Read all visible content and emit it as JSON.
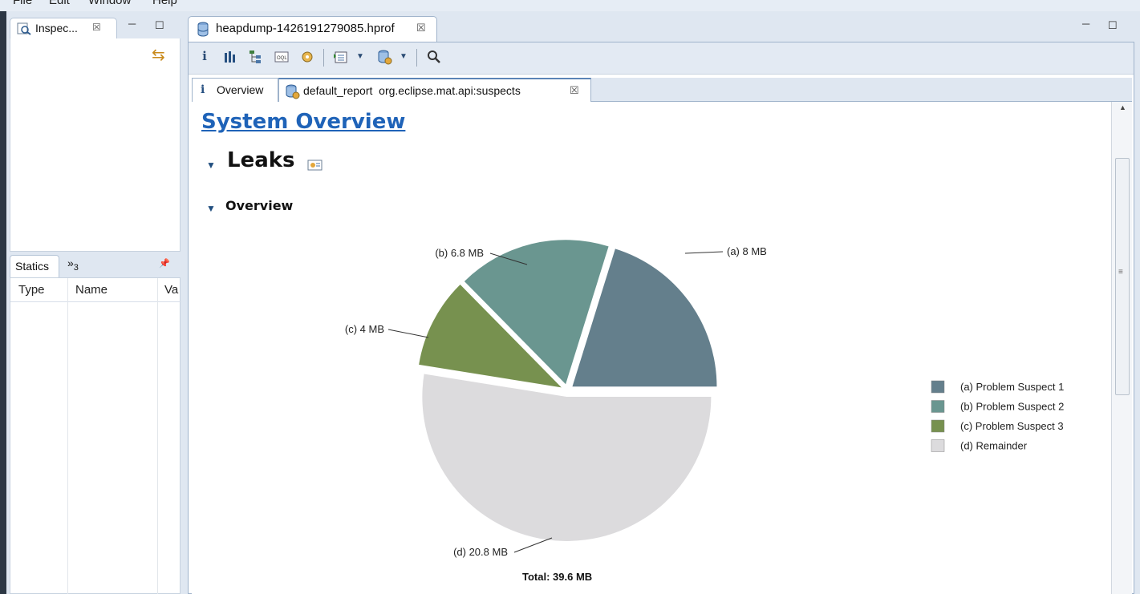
{
  "menu": [
    "File",
    "Edit",
    "Window",
    "Help"
  ],
  "inspector": {
    "tab_label": "Inspec...",
    "close_glyph": "☒",
    "min_glyph": "─",
    "max_glyph": "☐",
    "sync_glyph": "⇆"
  },
  "statics": {
    "tab_label": "Statics",
    "overflow_label": "»",
    "overflow_count": "3",
    "pin_glyph": "📌",
    "columns": [
      "Type",
      "Name",
      "Va"
    ]
  },
  "editor": {
    "tab_label": "heapdump-1426191279085.hprof",
    "close_glyph": "☒",
    "min_glyph": "─",
    "max_glyph": "☐",
    "toolbar_icons": [
      "info-icon",
      "histogram-icon",
      "dominator-tree-icon",
      "oql-icon",
      "thread-icon",
      "query-browser-icon",
      "report-icon",
      "search-icon"
    ],
    "subtabs": [
      {
        "icon": "i",
        "label": "Overview"
      },
      {
        "icon": "report",
        "label": "default_report  org.eclipse.mat.api:suspects",
        "close": "☒"
      }
    ]
  },
  "report": {
    "title": "System Overview",
    "section": "Leaks",
    "subsection": "Overview"
  },
  "chart_data": {
    "type": "pie",
    "title": "",
    "slices": [
      {
        "key": "a",
        "label": "(a)  8 MB",
        "legend": "(a)  Problem Suspect 1",
        "value": 8.0,
        "color": "#647f8c"
      },
      {
        "key": "b",
        "label": "(b)  6.8 MB",
        "legend": "(b)  Problem Suspect 2",
        "value": 6.8,
        "color": "#6a9690"
      },
      {
        "key": "c",
        "label": "(c)  4 MB",
        "legend": "(c)  Problem Suspect 3",
        "value": 4.0,
        "color": "#77914f"
      },
      {
        "key": "d",
        "label": "(d)  20.8 MB",
        "legend": "(d)  Remainder",
        "value": 20.8,
        "color": "#dcdbdd"
      }
    ],
    "total_label": "Total: 39.6 MB",
    "legend_position": "right"
  }
}
